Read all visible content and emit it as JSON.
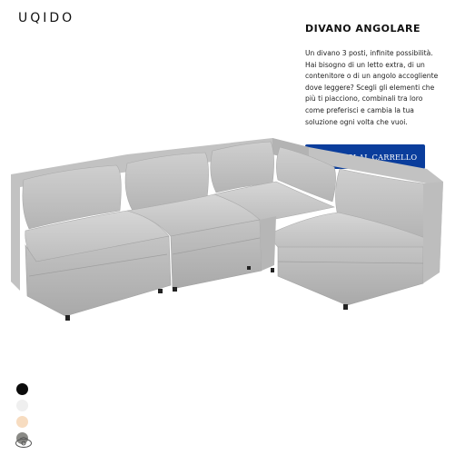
{
  "brand": {
    "logo": "UQIDO"
  },
  "product": {
    "title": "DIVANO ANGOLARE",
    "description": "Un divano 3 posti, infinite possibilità. Hai bisogno di un letto extra, di un contenitore o di un angolo accogliente dove leggere? Scegli gli elementi che più ti piacciono, combinali tra loro come preferisci e cambia la tua soluzione ogni volta che vuoi.",
    "cart_label": "AGGIUNGI AL CARRELLO"
  },
  "colors": {
    "accent": "#0a3d9c",
    "swatches": [
      {
        "name": "black",
        "hex": "#0b0b0b"
      },
      {
        "name": "white",
        "hex": "#efefef"
      },
      {
        "name": "beige",
        "hex": "#f7dcc0"
      },
      {
        "name": "gray",
        "hex": "#8a8a86"
      }
    ]
  },
  "icons": {
    "viewer": "3d-view-icon"
  }
}
